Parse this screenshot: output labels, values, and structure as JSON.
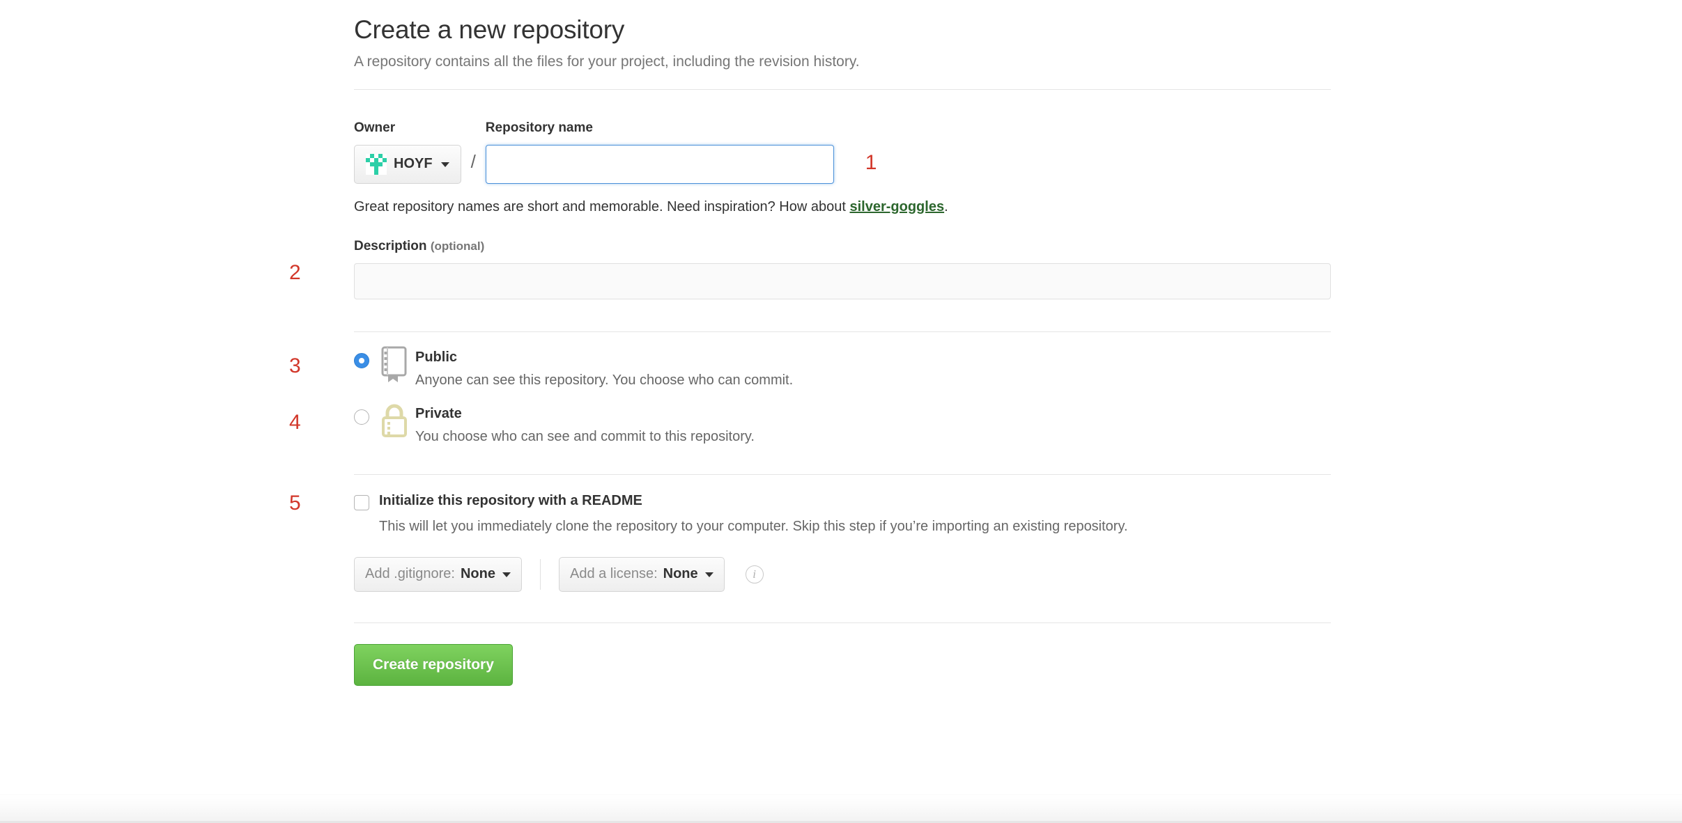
{
  "page": {
    "title": "Create a new repository",
    "subtitle": "A repository contains all the files for your project, including the revision history."
  },
  "owner": {
    "label": "Owner",
    "name": "HOYF",
    "avatar_color": "#2ccfa7",
    "avatar_icon": "identicon-avatar"
  },
  "repository_name": {
    "label": "Repository name",
    "value": "",
    "placeholder": "",
    "focused": true,
    "focus_color": "#4a90d9"
  },
  "hint": {
    "prefix": "Great repository names are short and memorable. Need inspiration? How about ",
    "suggestion": "silver-goggles",
    "suffix": ".",
    "suggestion_color": "#2c662d"
  },
  "description": {
    "label": "Description",
    "optional_label": "(optional)",
    "value": "",
    "placeholder": ""
  },
  "visibility": {
    "public": {
      "title": "Public",
      "description": "Anyone can see this repository. You choose who can commit.",
      "selected": true,
      "icon": "repo-icon",
      "icon_color": "#a8a8a8"
    },
    "private": {
      "title": "Private",
      "description": "You choose who can see and commit to this repository.",
      "selected": false,
      "icon": "lock-icon",
      "icon_color": "#ded9a8"
    }
  },
  "readme": {
    "label": "Initialize this repository with a README",
    "description": "This will let you immediately clone the repository to your computer. Skip this step if you’re importing an existing repository.",
    "checked": false
  },
  "gitignore_dropdown": {
    "label": "Add .gitignore:",
    "value": "None"
  },
  "license_dropdown": {
    "label": "Add a license:",
    "value": "None"
  },
  "info_icon": {
    "glyph": "i",
    "name": "info-icon"
  },
  "submit": {
    "label": "Create repository",
    "color": "#5cb340"
  },
  "annotations": {
    "color": "#d2372a",
    "items": [
      "1",
      "2",
      "3",
      "4",
      "5"
    ]
  }
}
